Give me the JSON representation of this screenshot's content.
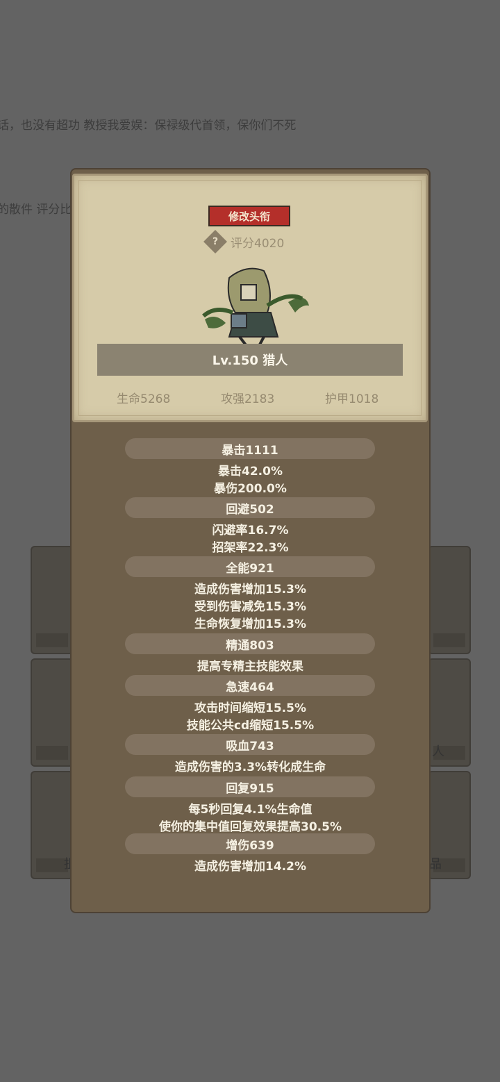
{
  "background": {
    "line1": "话，也没有超功 教授我爱娱：保禄级代首领，保你们不死",
    "line2": "的散件 评分比",
    "tile_labels": [
      "人",
      "抯",
      "品"
    ]
  },
  "card": {
    "edit_title_button": "修改头衔",
    "score": "评分4020",
    "level_name": "Lv.150 猎人",
    "hp": "生命5268",
    "attack": "攻强2183",
    "armor": "护甲1018"
  },
  "stats": {
    "crit": {
      "header": "暴击1111",
      "lines": [
        "暴击42.0%",
        "暴伤200.0%"
      ]
    },
    "dodge": {
      "header": "回避502",
      "lines": [
        "闪避率16.7%",
        "招架率22.3%"
      ]
    },
    "versatility": {
      "header": "全能921",
      "lines": [
        "造成伤害增加15.3%",
        "受到伤害减免15.3%",
        "生命恢复增加15.3%"
      ]
    },
    "mastery": {
      "header": "精通803",
      "lines": [
        "提高专精主技能效果"
      ]
    },
    "haste": {
      "header": "急速464",
      "lines": [
        "攻击时间缩短15.5%",
        "技能公共cd缩短15.5%"
      ]
    },
    "lifesteal": {
      "header": "吸血743",
      "lines": [
        "造成伤害的3.3%转化成生命"
      ]
    },
    "recovery": {
      "header": "回复915",
      "lines": [
        "每5秒回复4.1%生命值",
        "使你的集中值回复效果提高30.5%"
      ]
    },
    "damage": {
      "header": "增伤639",
      "lines": [
        "造成伤害增加14.2%"
      ]
    }
  },
  "colors": {
    "panel": "#6e5f4a",
    "card": "#d6cba9",
    "button": "#b42f2a",
    "pill": "#827361"
  }
}
